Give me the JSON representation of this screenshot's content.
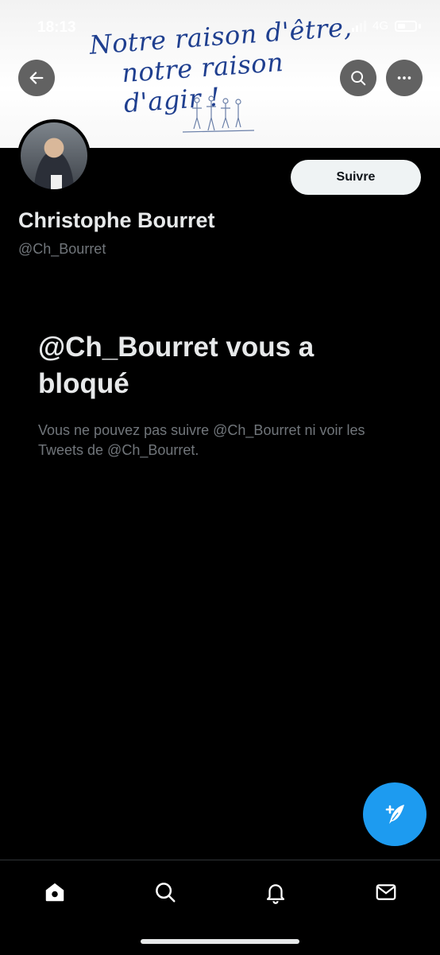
{
  "status_bar": {
    "time": "18:13",
    "network": "4G"
  },
  "banner": {
    "line1": "Notre raison d'être,",
    "line2": "notre raison d'agir !"
  },
  "header": {
    "back_icon": "arrow-left-icon",
    "search_icon": "search-icon",
    "more_icon": "more-horizontal-icon"
  },
  "profile": {
    "name": "Christophe Bourret",
    "handle": "@Ch_Bourret",
    "follow_label": "Suivre"
  },
  "blocked": {
    "title": "@Ch_Bourret vous a bloqué",
    "description": "Vous ne pouvez pas suivre @Ch_Bourret ni voir les Tweets de @Ch_Bourret."
  },
  "tabs": [
    "home-icon",
    "search-icon",
    "notifications-bell-icon",
    "messages-envelope-icon"
  ],
  "colors": {
    "accent": "#1d9bf0",
    "background": "#000000",
    "secondary_text": "#71767b"
  }
}
